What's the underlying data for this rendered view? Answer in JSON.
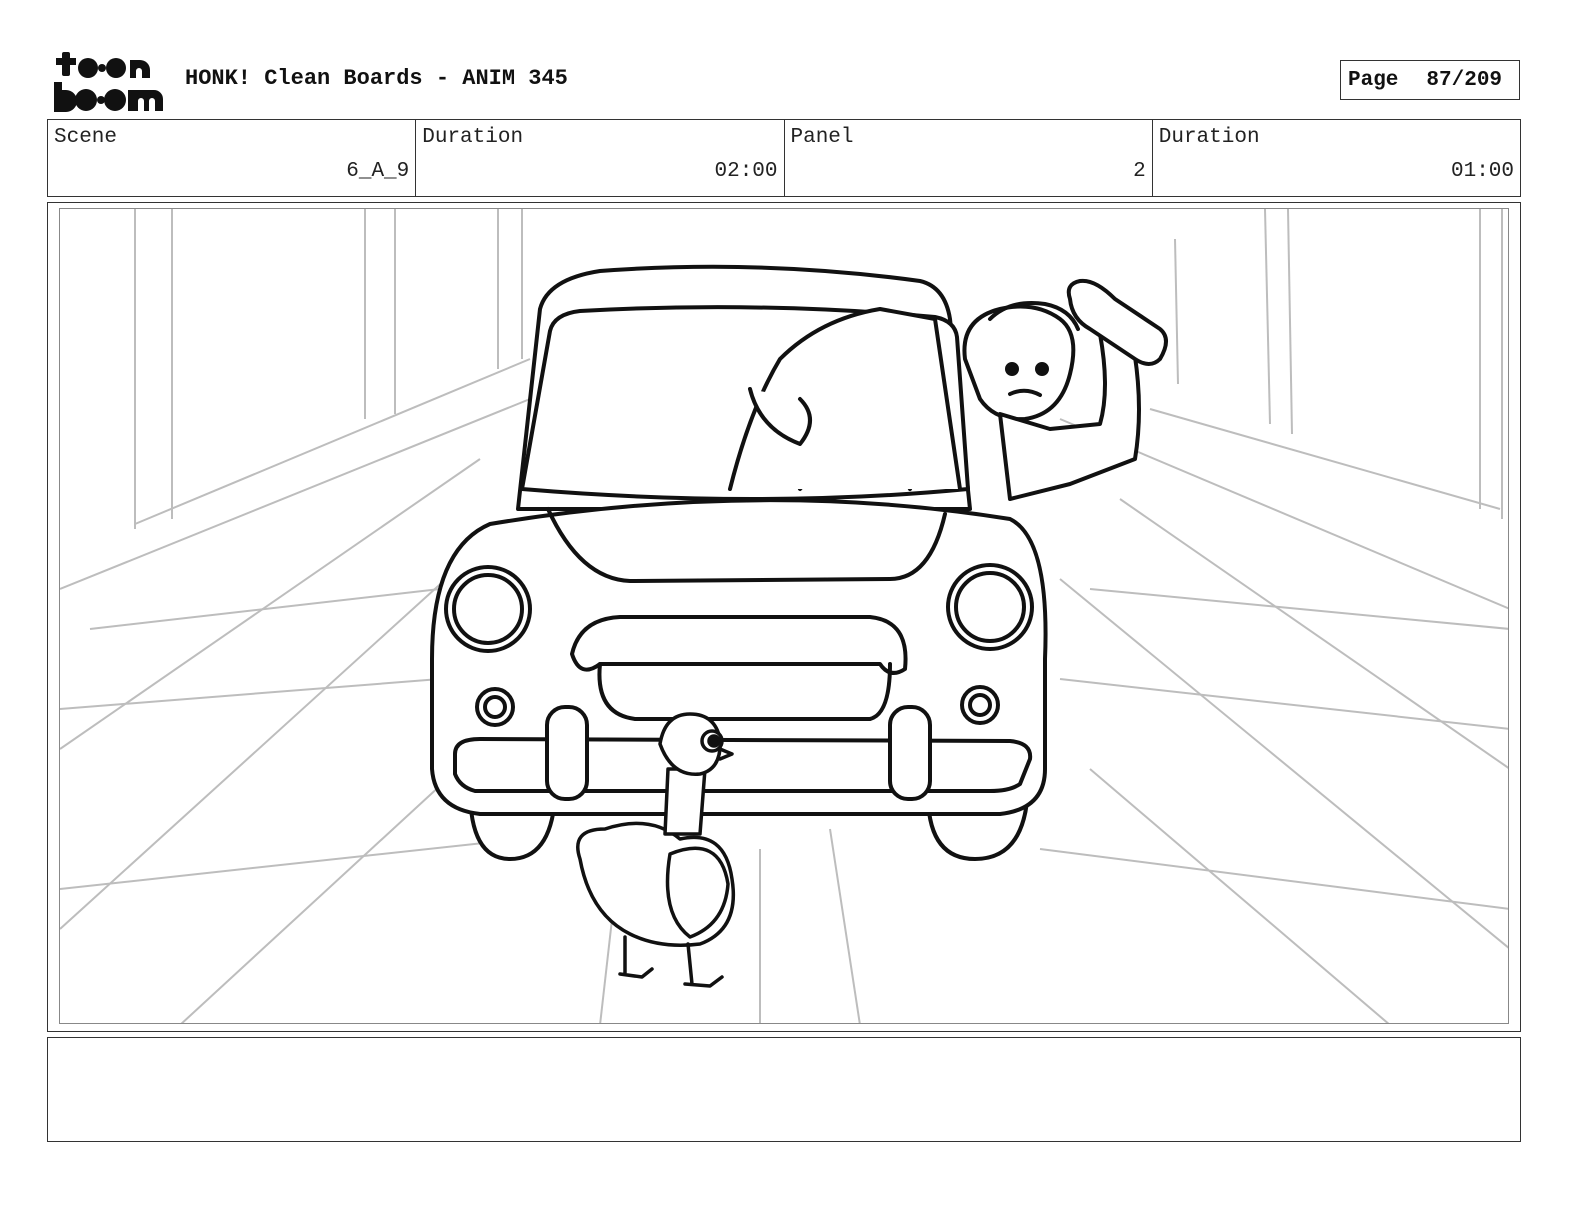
{
  "header": {
    "logo_text": "toon boom",
    "title": "HONK! Clean Boards - ANIM 345",
    "page_label": "Page",
    "page_number": "87/209"
  },
  "info": {
    "scene_label": "Scene",
    "scene_value": "6_A_9",
    "scene_duration_label": "Duration",
    "scene_duration_value": "02:00",
    "panel_label": "Panel",
    "panel_value": "2",
    "panel_duration_label": "Duration",
    "panel_duration_value": "01:00"
  },
  "panel": {
    "image_subject": "storyboard-sketch-car-and-goose"
  },
  "notes": {
    "text": ""
  }
}
